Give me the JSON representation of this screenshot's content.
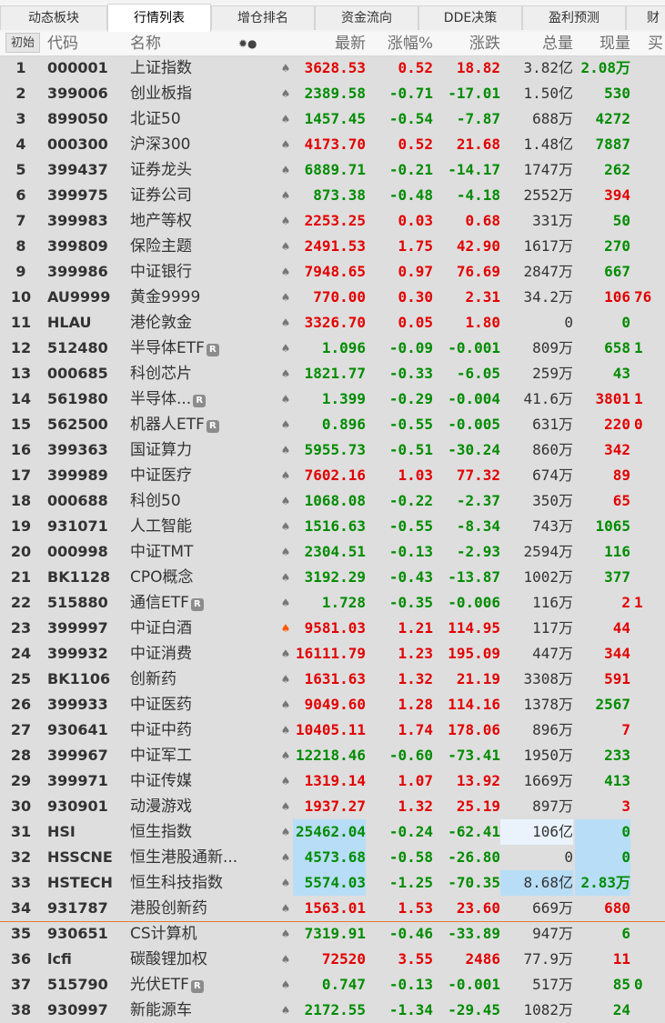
{
  "tabs": [
    "动态板块",
    "行情列表",
    "增仓排名",
    "资金流向",
    "DDE决策",
    "盈利预测",
    "财"
  ],
  "active_tab": 1,
  "header": {
    "init_label": "初始",
    "code": "代码",
    "name": "名称",
    "last": "最新",
    "pct": "涨幅%",
    "change": "涨跌",
    "volume": "总量",
    "current": "现量",
    "bid": "买"
  },
  "colors": {
    "up": "#e20000",
    "down": "#008c00",
    "neutral": "#333333",
    "highlight": "#b8ddf7",
    "separator": "#e07a3a"
  },
  "rows": [
    {
      "idx": "1",
      "code": "000001",
      "name": "上证指数",
      "last": "3628.53",
      "pct": "0.52",
      "change": "18.82",
      "vol": "3.82",
      "vol_unit": "亿",
      "cur": "2.08万",
      "bid": ""
    },
    {
      "idx": "2",
      "code": "399006",
      "name": "创业板指",
      "last": "2389.58",
      "pct": "-0.71",
      "change": "-17.01",
      "vol": "1.50",
      "vol_unit": "亿",
      "cur": "530",
      "bid": ""
    },
    {
      "idx": "3",
      "code": "899050",
      "name": "北证50",
      "last": "1457.45",
      "pct": "-0.54",
      "change": "-7.87",
      "vol": "688",
      "vol_unit": "万",
      "cur": "4272",
      "bid": ""
    },
    {
      "idx": "4",
      "code": "000300",
      "name": "沪深300",
      "last": "4173.70",
      "pct": "0.52",
      "change": "21.68",
      "vol": "1.48",
      "vol_unit": "亿",
      "cur": "7887",
      "bid": ""
    },
    {
      "idx": "5",
      "code": "399437",
      "name": "证券龙头",
      "last": "6889.71",
      "pct": "-0.21",
      "change": "-14.17",
      "vol": "1747",
      "vol_unit": "万",
      "cur": "262",
      "bid": ""
    },
    {
      "idx": "6",
      "code": "399975",
      "name": "证券公司",
      "last": "873.38",
      "pct": "-0.48",
      "change": "-4.18",
      "vol": "2552",
      "vol_unit": "万",
      "cur": "394",
      "bid": ""
    },
    {
      "idx": "7",
      "code": "399983",
      "name": "地产等权",
      "last": "2253.25",
      "pct": "0.03",
      "change": "0.68",
      "vol": "331",
      "vol_unit": "万",
      "cur": "50",
      "bid": ""
    },
    {
      "idx": "8",
      "code": "399809",
      "name": "保险主题",
      "last": "2491.53",
      "pct": "1.75",
      "change": "42.90",
      "vol": "1617",
      "vol_unit": "万",
      "cur": "270",
      "bid": ""
    },
    {
      "idx": "9",
      "code": "399986",
      "name": "中证银行",
      "last": "7948.65",
      "pct": "0.97",
      "change": "76.69",
      "vol": "2847",
      "vol_unit": "万",
      "cur": "667",
      "bid": ""
    },
    {
      "idx": "10",
      "code": "AU9999",
      "name": "黄金9999",
      "last": "770.00",
      "pct": "0.30",
      "change": "2.31",
      "vol": "34.2",
      "vol_unit": "万",
      "cur": "106",
      "bid": "76"
    },
    {
      "idx": "11",
      "code": "HLAU",
      "name": "港伦敦金",
      "last": "3326.70",
      "pct": "0.05",
      "change": "1.80",
      "vol": "0",
      "vol_unit": "",
      "cur": "0",
      "bid": ""
    },
    {
      "idx": "12",
      "code": "512480",
      "name": "半导体ETF",
      "last": "1.096",
      "pct": "-0.09",
      "change": "-0.001",
      "vol": "809",
      "vol_unit": "万",
      "cur": "658",
      "bid": "1"
    },
    {
      "idx": "13",
      "code": "000685",
      "name": "科创芯片",
      "last": "1821.77",
      "pct": "-0.33",
      "change": "-6.05",
      "vol": "259",
      "vol_unit": "万",
      "cur": "43",
      "bid": ""
    },
    {
      "idx": "14",
      "code": "561980",
      "name": "半导体...",
      "last": "1.399",
      "pct": "-0.29",
      "change": "-0.004",
      "vol": "41.6",
      "vol_unit": "万",
      "cur": "3801",
      "bid": "1"
    },
    {
      "idx": "15",
      "code": "562500",
      "name": "机器人ETF",
      "last": "0.896",
      "pct": "-0.55",
      "change": "-0.005",
      "vol": "631",
      "vol_unit": "万",
      "cur": "220",
      "bid": "0"
    },
    {
      "idx": "16",
      "code": "399363",
      "name": "国证算力",
      "last": "5955.73",
      "pct": "-0.51",
      "change": "-30.24",
      "vol": "860",
      "vol_unit": "万",
      "cur": "342",
      "bid": ""
    },
    {
      "idx": "17",
      "code": "399989",
      "name": "中证医疗",
      "last": "7602.16",
      "pct": "1.03",
      "change": "77.32",
      "vol": "674",
      "vol_unit": "万",
      "cur": "89",
      "bid": ""
    },
    {
      "idx": "18",
      "code": "000688",
      "name": "科创50",
      "last": "1068.08",
      "pct": "-0.22",
      "change": "-2.37",
      "vol": "350",
      "vol_unit": "万",
      "cur": "65",
      "bid": ""
    },
    {
      "idx": "19",
      "code": "931071",
      "name": "人工智能",
      "last": "1516.63",
      "pct": "-0.55",
      "change": "-8.34",
      "vol": "743",
      "vol_unit": "万",
      "cur": "1065",
      "bid": ""
    },
    {
      "idx": "20",
      "code": "000998",
      "name": "中证TMT",
      "last": "2304.51",
      "pct": "-0.13",
      "change": "-2.93",
      "vol": "2594",
      "vol_unit": "万",
      "cur": "116",
      "bid": ""
    },
    {
      "idx": "21",
      "code": "BK1128",
      "name": "CPO概念",
      "last": "3192.29",
      "pct": "-0.43",
      "change": "-13.87",
      "vol": "1002",
      "vol_unit": "万",
      "cur": "377",
      "bid": ""
    },
    {
      "idx": "22",
      "code": "515880",
      "name": "通信ETF",
      "last": "1.728",
      "pct": "-0.35",
      "change": "-0.006",
      "vol": "116",
      "vol_unit": "万",
      "cur": "2",
      "bid": "1"
    },
    {
      "idx": "23",
      "code": "399997",
      "name": "中证白酒",
      "last": "9581.03",
      "pct": "1.21",
      "change": "114.95",
      "vol": "117",
      "vol_unit": "万",
      "cur": "44",
      "bid": ""
    },
    {
      "idx": "24",
      "code": "399932",
      "name": "中证消费",
      "last": "16111.79",
      "pct": "1.23",
      "change": "195.09",
      "vol": "447",
      "vol_unit": "万",
      "cur": "344",
      "bid": ""
    },
    {
      "idx": "25",
      "code": "BK1106",
      "name": "创新药",
      "last": "1631.63",
      "pct": "1.32",
      "change": "21.19",
      "vol": "3308",
      "vol_unit": "万",
      "cur": "591",
      "bid": ""
    },
    {
      "idx": "26",
      "code": "399933",
      "name": "中证医药",
      "last": "9049.60",
      "pct": "1.28",
      "change": "114.16",
      "vol": "1378",
      "vol_unit": "万",
      "cur": "2567",
      "bid": ""
    },
    {
      "idx": "27",
      "code": "930641",
      "name": "中证中药",
      "last": "10405.11",
      "pct": "1.74",
      "change": "178.06",
      "vol": "896",
      "vol_unit": "万",
      "cur": "7",
      "bid": ""
    },
    {
      "idx": "28",
      "code": "399967",
      "name": "中证军工",
      "last": "12218.46",
      "pct": "-0.60",
      "change": "-73.41",
      "vol": "1950",
      "vol_unit": "万",
      "cur": "233",
      "bid": ""
    },
    {
      "idx": "29",
      "code": "399971",
      "name": "中证传媒",
      "last": "1319.14",
      "pct": "1.07",
      "change": "13.92",
      "vol": "1669",
      "vol_unit": "万",
      "cur": "413",
      "bid": ""
    },
    {
      "idx": "30",
      "code": "930901",
      "name": "动漫游戏",
      "last": "1937.27",
      "pct": "1.32",
      "change": "25.19",
      "vol": "897",
      "vol_unit": "万",
      "cur": "3",
      "bid": ""
    },
    {
      "idx": "31",
      "code": "HSI",
      "name": "恒生指数",
      "last": "25462.04",
      "pct": "-0.24",
      "change": "-62.41",
      "vol": "106",
      "vol_unit": "亿",
      "cur": "0",
      "bid": ""
    },
    {
      "idx": "32",
      "code": "HSSCNE",
      "name": "恒生港股通新...",
      "last": "4573.68",
      "pct": "-0.58",
      "change": "-26.80",
      "vol": "0",
      "vol_unit": "",
      "cur": "0",
      "bid": ""
    },
    {
      "idx": "33",
      "code": "HSTECH",
      "name": "恒生科技指数",
      "last": "5574.03",
      "pct": "-1.25",
      "change": "-70.35",
      "vol": "8.68",
      "vol_unit": "亿",
      "cur": "2.83万",
      "bid": ""
    },
    {
      "idx": "34",
      "code": "931787",
      "name": "港股创新药",
      "last": "1563.01",
      "pct": "1.53",
      "change": "23.60",
      "vol": "669",
      "vol_unit": "万",
      "cur": "680",
      "bid": ""
    },
    {
      "idx": "35",
      "code": "930651",
      "name": "CS计算机",
      "last": "7319.91",
      "pct": "-0.46",
      "change": "-33.89",
      "vol": "947",
      "vol_unit": "万",
      "cur": "6",
      "bid": ""
    },
    {
      "idx": "36",
      "code": "lcfi",
      "name": "碳酸锂加权",
      "last": "72520",
      "pct": "3.55",
      "change": "2486",
      "vol": "77.9",
      "vol_unit": "万",
      "cur": "11",
      "bid": ""
    },
    {
      "idx": "37",
      "code": "515790",
      "name": "光伏ETF",
      "last": "0.747",
      "pct": "-0.13",
      "change": "-0.001",
      "vol": "517",
      "vol_unit": "万",
      "cur": "85",
      "bid": "0"
    },
    {
      "idx": "38",
      "code": "930997",
      "name": "新能源车",
      "last": "2172.55",
      "pct": "-1.34",
      "change": "-29.45",
      "vol": "1082",
      "vol_unit": "万",
      "cur": "24",
      "bid": ""
    }
  ],
  "row_flags": {
    "r_badge": [
      "12",
      "14",
      "15",
      "22",
      "37"
    ],
    "updown_icon": [
      "15",
      "22"
    ],
    "bell_alert": [
      "23"
    ],
    "cur_color": {
      "1": "green",
      "2": "green",
      "3": "green",
      "4": "green",
      "5": "green",
      "6": "red",
      "7": "green",
      "8": "green",
      "9": "green",
      "10": "red",
      "11": "green",
      "12": "green",
      "13": "green",
      "14": "red",
      "15": "red",
      "16": "red",
      "17": "red",
      "18": "red",
      "19": "green",
      "20": "green",
      "21": "green",
      "22": "red",
      "23": "red",
      "24": "red",
      "25": "red",
      "26": "green",
      "27": "red",
      "28": "green",
      "29": "green",
      "30": "red",
      "31": "green",
      "32": "green",
      "33": "green",
      "34": "red",
      "35": "green",
      "36": "red",
      "37": "green",
      "38": "green"
    },
    "price_highlight": [
      "31",
      "32",
      "33"
    ],
    "vol_highlight_light": [
      "31"
    ],
    "vol_highlight_blue": [
      "33"
    ],
    "cur_highlight": [
      "31",
      "32",
      "33"
    ]
  }
}
